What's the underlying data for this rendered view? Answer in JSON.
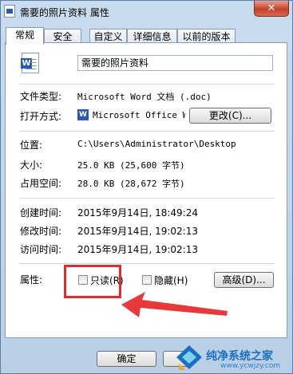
{
  "window": {
    "title": "需要的照片资料 属性",
    "close_glyph": "✕"
  },
  "tabs": [
    "常规",
    "安全",
    "自定义",
    "详细信息",
    "以前的版本"
  ],
  "file": {
    "name": "需要的照片资料",
    "icon_letter": "W",
    "type_label": "文件类型:",
    "type_value": "Microsoft Word 文档 (.doc)",
    "open_label": "打开方式:",
    "open_value": "Microsoft Office Wo",
    "change_button": "更改(C)..."
  },
  "location": {
    "location_label": "位置:",
    "location_value": "C:\\Users\\Administrator\\Desktop",
    "size_label": "大小:",
    "size_value": "25.0 KB (25,600 字节)",
    "disk_label": "占用空间:",
    "disk_value": "28.0 KB (28,672 字节)"
  },
  "times": {
    "created_label": "创建时间:",
    "created_value": "2015年9月14日, 18:49:24",
    "modified_label": "修改时间:",
    "modified_value": "2015年9月14日, 19:02:13",
    "accessed_label": "访问时间:",
    "accessed_value": "2015年9月14日, 19:02:13"
  },
  "attributes": {
    "label": "属性:",
    "readonly_label": "只读(R)",
    "hidden_label": "隐藏(H)",
    "advanced_button": "高级(D)..."
  },
  "footer": {
    "ok_button": "确定"
  },
  "watermark": {
    "name": "纯净系统之家",
    "url": "www.ycwjzy.com"
  },
  "colors": {
    "highlight": "#e02c2c",
    "accent": "#2a5ab3"
  }
}
